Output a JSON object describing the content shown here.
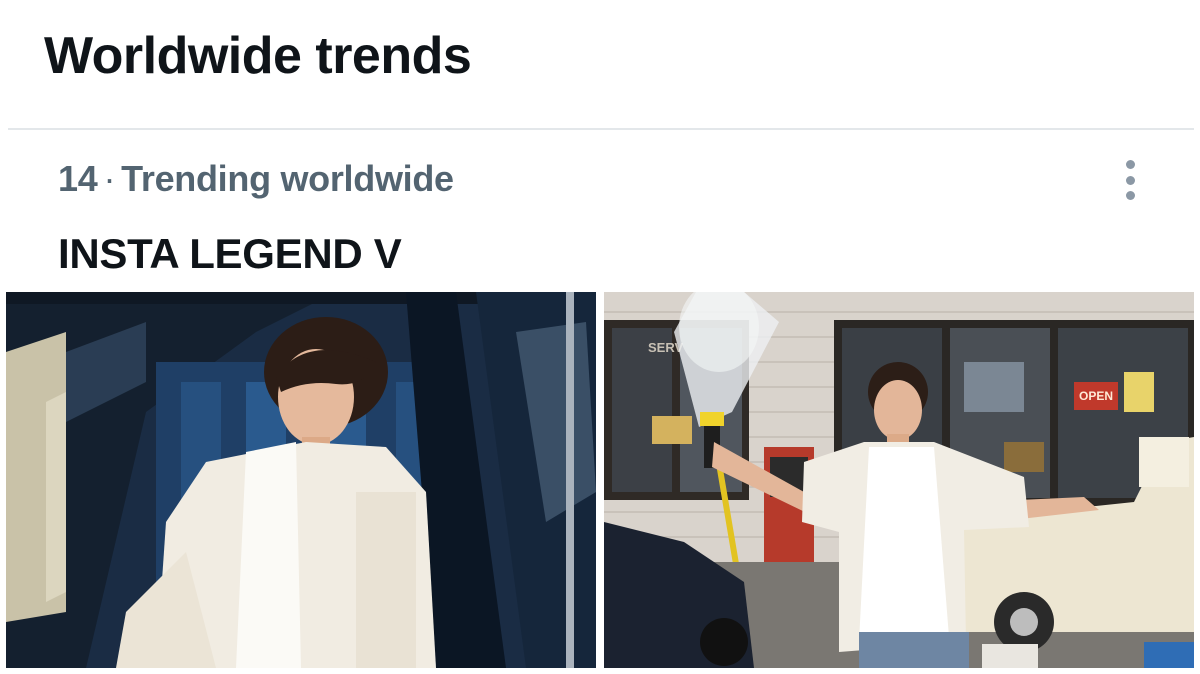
{
  "header": {
    "title": "Worldwide trends"
  },
  "trend": {
    "rank": "14",
    "separator": "·",
    "context": "Trending worldwide",
    "name": "INSTA LEGEND V",
    "more_icon": "more-vertical-icon"
  },
  "media": {
    "photos": [
      {
        "scene": "car-interior-portrait"
      },
      {
        "scene": "gas-station-hose-portrait",
        "signs": [
          "SERV",
          "OPEN"
        ]
      }
    ]
  }
}
